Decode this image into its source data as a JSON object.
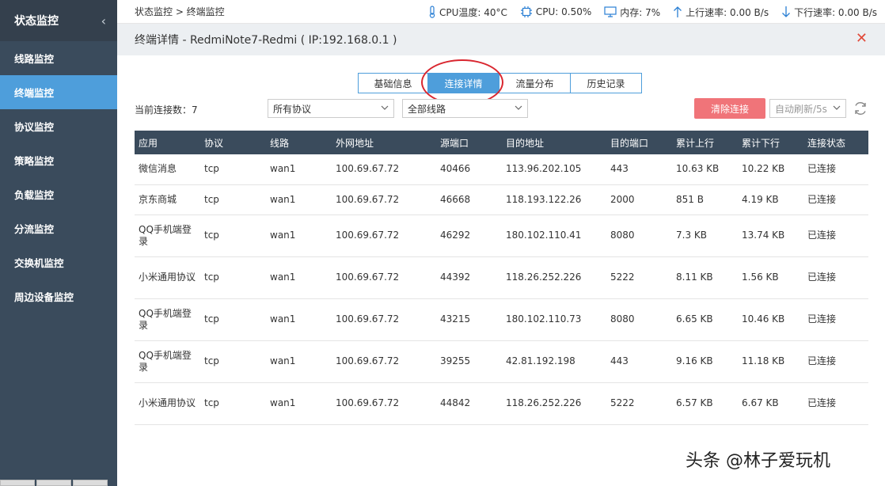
{
  "sidebar": {
    "title": "状态监控",
    "items": [
      {
        "label": "线路监控",
        "active": false
      },
      {
        "label": "终端监控",
        "active": true
      },
      {
        "label": "协议监控",
        "active": false
      },
      {
        "label": "策略监控",
        "active": false
      },
      {
        "label": "负载监控",
        "active": false
      },
      {
        "label": "分流监控",
        "active": false
      },
      {
        "label": "交换机监控",
        "active": false
      },
      {
        "label": "周边设备监控",
        "active": false
      }
    ]
  },
  "breadcrumb": "状态监控 > 终端监控",
  "stats": {
    "cpu_temp": "CPU温度: 40°C",
    "cpu": "CPU: 0.50%",
    "memory": "内存: 7%",
    "upload": "上行速率: 0.00 B/s",
    "download": "下行速率: 0.00 B/s"
  },
  "page_title": "终端详情 - RedmiNote7-Redmi ( IP:192.168.0.1 )",
  "tabs": [
    {
      "label": "基础信息",
      "active": false
    },
    {
      "label": "连接详情",
      "active": true
    },
    {
      "label": "流量分布",
      "active": false
    },
    {
      "label": "历史记录",
      "active": false
    }
  ],
  "filters": {
    "count_label": "当前连接数：7",
    "protocol": "所有协议",
    "line": "全部线路",
    "clear_button": "清除连接",
    "auto_refresh": "自动刷新/5s"
  },
  "table": {
    "headers": [
      "应用",
      "协议",
      "线路",
      "外网地址",
      "源端口",
      "目的地址",
      "目的端口",
      "累计上行",
      "累计下行",
      "连接状态"
    ],
    "rows": [
      [
        "微信消息",
        "tcp",
        "wan1",
        "100.69.67.72",
        "40466",
        "113.96.202.105",
        "443",
        "10.63 KB",
        "10.22 KB",
        "已连接"
      ],
      [
        "京东商城",
        "tcp",
        "wan1",
        "100.69.67.72",
        "46668",
        "118.193.122.26",
        "2000",
        "851 B",
        "4.19 KB",
        "已连接"
      ],
      [
        "QQ手机端登录",
        "tcp",
        "wan1",
        "100.69.67.72",
        "46292",
        "180.102.110.41",
        "8080",
        "7.3 KB",
        "13.74 KB",
        "已连接"
      ],
      [
        "小米通用协议",
        "tcp",
        "wan1",
        "100.69.67.72",
        "44392",
        "118.26.252.226",
        "5222",
        "8.11 KB",
        "1.56 KB",
        "已连接"
      ],
      [
        "QQ手机端登录",
        "tcp",
        "wan1",
        "100.69.67.72",
        "43215",
        "180.102.110.73",
        "8080",
        "6.65 KB",
        "10.46 KB",
        "已连接"
      ],
      [
        "QQ手机端登录",
        "tcp",
        "wan1",
        "100.69.67.72",
        "39255",
        "42.81.192.198",
        "443",
        "9.16 KB",
        "11.18 KB",
        "已连接"
      ],
      [
        "小米通用协议",
        "tcp",
        "wan1",
        "100.69.67.72",
        "44842",
        "118.26.252.226",
        "5222",
        "6.57 KB",
        "6.67 KB",
        "已连接"
      ]
    ]
  },
  "watermark": "头条 @林子爱玩机",
  "colors": {
    "sidebar_bg": "#3a4b5c",
    "accent": "#4e9edb",
    "danger": "#f07479",
    "close": "#e14b3b",
    "highlight": "#d9262f"
  },
  "icons": {
    "sidebar_collapse": "chevron-left-icon",
    "temp": "thermometer-icon",
    "cpu": "cpu-chip-icon",
    "memory": "monitor-icon",
    "upload": "arrow-up-icon",
    "download": "arrow-down-icon",
    "close": "close-icon",
    "refresh": "refresh-icon"
  }
}
